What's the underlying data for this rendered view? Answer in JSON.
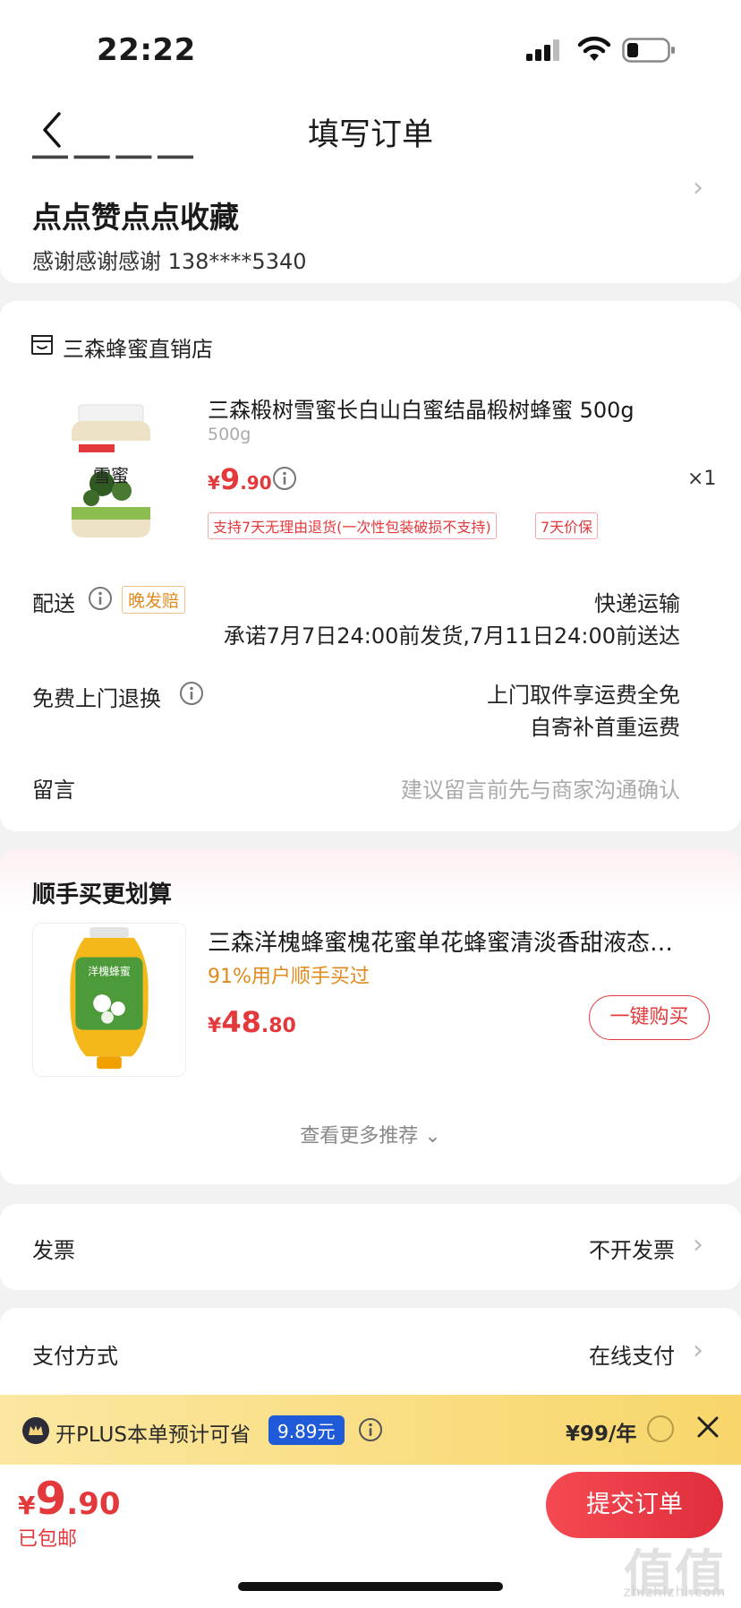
{
  "status_bar": {
    "time": "22:22"
  },
  "header": {
    "title": "填写订单"
  },
  "address": {
    "name": "点点赞点点收藏",
    "contact": "感谢感谢感谢  138****5340"
  },
  "shop": {
    "name": "三森蜂蜜直销店",
    "product": {
      "title": "三森椴树雪蜜长白山白蜜结晶椴树蜂蜜 500g",
      "spec": "500g",
      "price_currency": "¥",
      "price_int": "9",
      "price_dec": ".90",
      "qty": "×1",
      "tags": [
        "支持7天无理由退货(一次性包装破损不支持)",
        "7天价保"
      ]
    },
    "delivery": {
      "label": "配送",
      "badge": "晚发赔",
      "method": "快递运输",
      "promise": "承诺7月7日24:00前发货,7月11日24:00前送达"
    },
    "return": {
      "label": "免费上门退换",
      "line1": "上门取件享运费全免",
      "line2": "自寄补首重运费"
    },
    "message": {
      "label": "留言",
      "placeholder": "建议留言前先与商家沟通确认"
    }
  },
  "recommend": {
    "title": "顺手买更划算",
    "product_name": "三森洋槐蜂蜜槐花蜜单花蜂蜜清淡香甜液态…",
    "buy_rate": "91%用户顺手买过",
    "price_currency": "¥",
    "price_int": "48",
    "price_dec": ".80",
    "buy_button": "一键购买",
    "more": "查看更多推荐 ⌄"
  },
  "invoice": {
    "label": "发票",
    "value": "不开发票"
  },
  "payment": {
    "label": "支付方式",
    "value": "在线支付"
  },
  "plus": {
    "text": "开PLUS本单预计可省",
    "save": "9.89元",
    "price": "¥99/年"
  },
  "bottom": {
    "currency": "¥",
    "total_int": "9",
    "total_dec": ".90",
    "shipping": "已包邮",
    "submit": "提交订单"
  },
  "watermark": {
    "main": "值值值",
    "sub": "zhizhizhi.com"
  },
  "colors": {
    "accent": "#e4393c",
    "plus_blue": "#1f5bd8",
    "plus_gold": "#f8d66a"
  }
}
